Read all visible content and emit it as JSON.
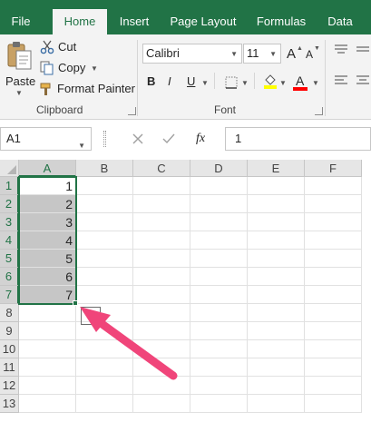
{
  "ribbon": {
    "tabs": [
      "File",
      "Home",
      "Insert",
      "Page Layout",
      "Formulas",
      "Data"
    ],
    "active_tab": "Home",
    "clipboard": {
      "paste_label": "Paste",
      "cut_label": "Cut",
      "copy_label": "Copy",
      "format_painter_label": "Format Painter",
      "group_label": "Clipboard"
    },
    "font": {
      "font_name": "Calibri",
      "font_size": "11",
      "bold_label": "B",
      "italic_label": "I",
      "underline_label": "U",
      "grow_label": "A",
      "shrink_label": "A",
      "font_color_label": "A",
      "group_label": "Font",
      "fill_color": "#ffff00",
      "font_color": "#ff0000"
    }
  },
  "formula_bar": {
    "name_box": "A1",
    "fx_label": "fx",
    "value": "1"
  },
  "sheet": {
    "columns": [
      "A",
      "B",
      "C",
      "D",
      "E",
      "F"
    ],
    "rows": [
      "1",
      "2",
      "3",
      "4",
      "5",
      "6",
      "7",
      "8",
      "9",
      "10",
      "11",
      "12",
      "13"
    ],
    "column_a_values": [
      "1",
      "2",
      "3",
      "4",
      "5",
      "6",
      "7"
    ],
    "accent_color": "#217346",
    "arrow_color": "#f0457a"
  }
}
